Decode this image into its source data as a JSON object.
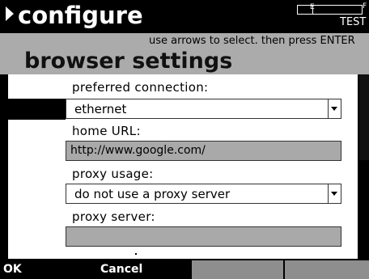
{
  "header": {
    "title": "configure",
    "battery_e": "E",
    "battery_f": "F",
    "mode": "TEST"
  },
  "subheader": {
    "hint": "use arrows to select. then press ENTER",
    "section_title": "browser settings"
  },
  "form": {
    "preferred_connection": {
      "label": "preferred connection:",
      "value": "ethernet"
    },
    "home_url": {
      "label": "home URL:",
      "value": "http://www.google.com/"
    },
    "proxy_usage": {
      "label": "proxy usage:",
      "value": "do not use a proxy server"
    },
    "proxy_server": {
      "label": "proxy server:",
      "value": ""
    }
  },
  "softkeys": {
    "ok": "OK",
    "cancel": "Cancel",
    "key3": "",
    "key4": ""
  }
}
